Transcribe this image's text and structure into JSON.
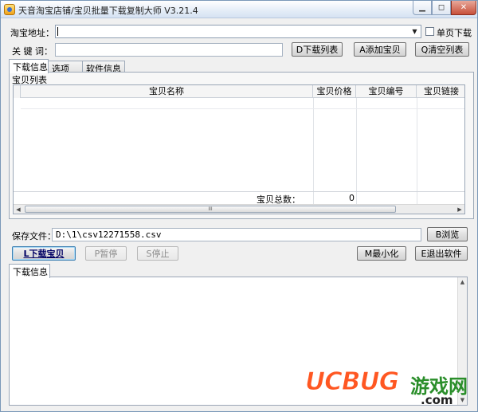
{
  "window": {
    "title": "天音淘宝店铺/宝贝批量下载复制大师 V3.21.4",
    "controls": {
      "minimize": "▁",
      "maximize": "◻",
      "close": "✕"
    }
  },
  "form": {
    "url_label": "淘宝地址：",
    "url_value": "",
    "single_page_label": "单页下载",
    "keyword_label": "关 键 词：",
    "keyword_value": "",
    "download_list_button": "D下载列表",
    "add_item_button": "A添加宝贝",
    "clear_list_button": "Q清空列表"
  },
  "tabs": [
    "下载信息",
    "选项",
    "软件信息"
  ],
  "group_label": "宝贝列表",
  "grid": {
    "columns": [
      "宝贝名称",
      "宝贝价格",
      "宝贝编号",
      "宝贝链接"
    ],
    "total_label": "宝贝总数：",
    "total_value": "0",
    "scroll_thumb": "III"
  },
  "save": {
    "label": "保存文件：",
    "path": "D:\\1\\csv12271558.csv",
    "browse_button": "B浏览"
  },
  "actions": {
    "download_button": "L下载宝贝",
    "pause_button": "P暂停",
    "stop_button": "S停止",
    "minimize_button": "M最小化",
    "exit_button": "E退出软件"
  },
  "log_tab": "下载信息",
  "watermark": {
    "brand": "UCBUG",
    "cn": "游戏网",
    "domain": ".com"
  }
}
